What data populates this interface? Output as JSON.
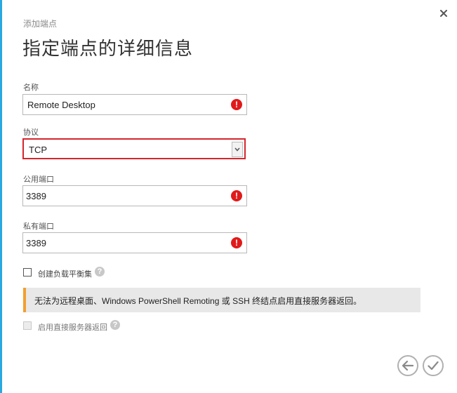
{
  "dialog": {
    "subtitle": "添加端点",
    "title": "指定端点的详细信息",
    "close_icon": "close-icon",
    "accent_color": "#2aa8df"
  },
  "form": {
    "name": {
      "label": "名称",
      "value": "Remote Desktop",
      "error_icon": "error-icon"
    },
    "protocol": {
      "label": "协议",
      "value": "TCP",
      "border_color": "#d3262d"
    },
    "public_port": {
      "label": "公用端口",
      "value": "3389",
      "error_icon": "error-icon"
    },
    "private_port": {
      "label": "私有端口",
      "value": "3389",
      "error_icon": "error-icon"
    },
    "load_balanced": {
      "label": "创建负载平衡集",
      "checked": false,
      "help_icon": "help-icon"
    },
    "direct_server_return": {
      "label": "启用直接服务器返回",
      "checked": false,
      "disabled": true,
      "help_icon": "help-icon"
    }
  },
  "notice": {
    "text": "无法为远程桌面、Windows PowerShell Remoting 或 SSH 终结点启用直接服务器返回。",
    "accent_color": "#f0a030"
  },
  "footer": {
    "back_icon": "back-arrow-icon",
    "confirm_icon": "check-icon"
  }
}
